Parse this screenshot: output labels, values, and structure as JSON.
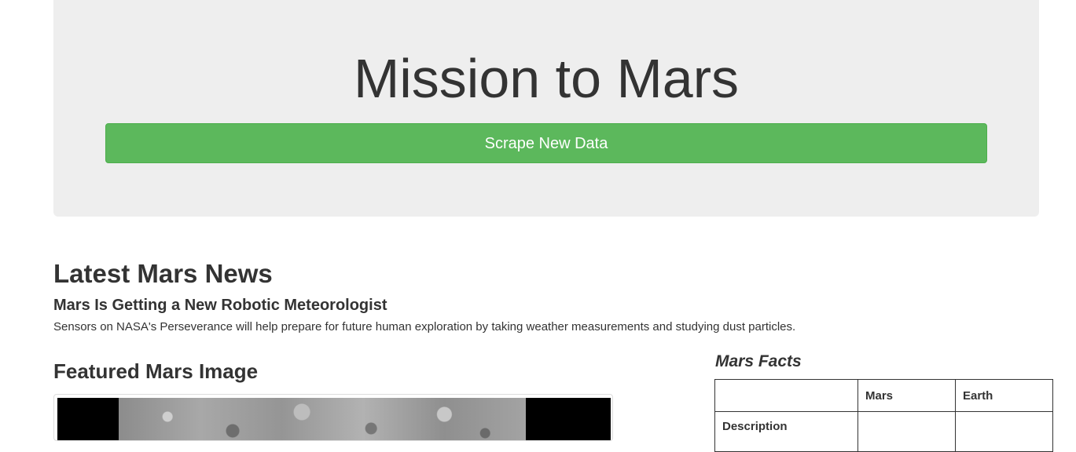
{
  "header": {
    "title": "Mission to Mars",
    "scrape_button_label": "Scrape New Data"
  },
  "news": {
    "heading": "Latest Mars News",
    "title": "Mars Is Getting a New Robotic Meteorologist",
    "body": "Sensors on NASA's Perseverance will help prepare for future human exploration by taking weather measurements and studying dust particles."
  },
  "featured": {
    "heading": "Featured Mars Image"
  },
  "facts": {
    "heading": "Mars Facts",
    "columns": [
      "",
      "Mars",
      "Earth"
    ],
    "rows": [
      [
        "Description",
        "",
        ""
      ]
    ]
  },
  "colors": {
    "jumbotron_bg": "#eeeeee",
    "button_green": "#5cb85c",
    "text": "#333333"
  }
}
